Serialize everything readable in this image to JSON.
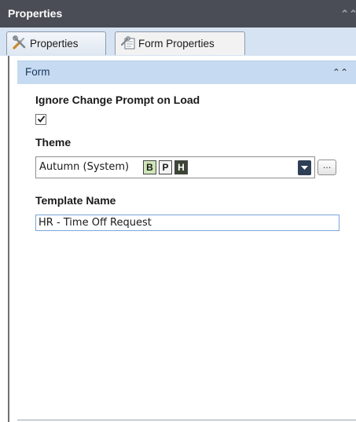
{
  "panel": {
    "title": "Properties",
    "collapse_glyph": "⌃⌃"
  },
  "tabs": [
    {
      "label": "Properties",
      "icon": "wrench-screwdriver-icon",
      "active": false
    },
    {
      "label": "Form Properties",
      "icon": "form-properties-icon",
      "active": true
    }
  ],
  "section": {
    "title": "Form",
    "collapse_glyph": "⌃⌃"
  },
  "fields": {
    "ignore_change": {
      "label": "Ignore Change Prompt on Load",
      "checked": true
    },
    "theme": {
      "label": "Theme",
      "value": "Autumn (System)",
      "swatches": [
        {
          "letter": "B",
          "bg": "#cfe6b8",
          "fg": "#1a1a1a"
        },
        {
          "letter": "P",
          "bg": "#f4f4f4",
          "fg": "#1a1a1a"
        },
        {
          "letter": "H",
          "bg": "#3d4636",
          "fg": "#ffffff"
        }
      ],
      "more_button": "..."
    },
    "template_name": {
      "label": "Template Name",
      "value": "HR - Time Off Request"
    }
  },
  "colors": {
    "header_bg": "#4a4d55",
    "tabstrip_bg": "#d6e3f3",
    "section_bg": "#c6dbf1",
    "section_text": "#17375e"
  }
}
